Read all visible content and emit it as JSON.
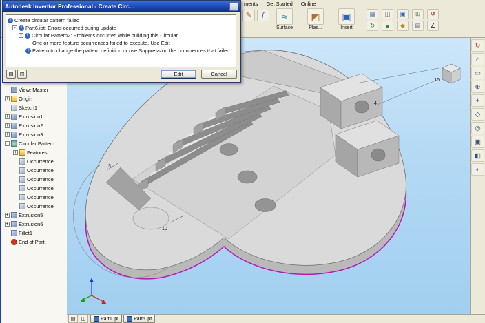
{
  "dialog": {
    "title": "Autodesk Inventor Professional - Create Circ...",
    "messages": [
      {
        "text": "Create circular pattern failed",
        "depth": "d0",
        "exp": "none",
        "icon": "info"
      },
      {
        "text": "Part6.ipt: Errors occurred during update",
        "depth": "d1",
        "exp": "minus",
        "icon": "info"
      },
      {
        "text": "Circular Pattern2: Problems occurred while building this Circular",
        "depth": "d2",
        "exp": "minus",
        "icon": "info"
      },
      {
        "text": "One or more feature occurrences failed to execute.  Use Edit",
        "depth": "d3",
        "exp": "none",
        "icon": "none"
      },
      {
        "text": "Pattern to change the pattern definition or use Suppress on the occurrences that failed.",
        "depth": "d3b",
        "exp": "none",
        "icon": "info"
      }
    ],
    "toolbar_buttons": [
      {
        "name": "save-report-icon",
        "glyph": "▤"
      },
      {
        "name": "copy-icon",
        "glyph": "◫"
      }
    ],
    "edit_label": "Edit",
    "cancel_label": "Cancel"
  },
  "menubar": {
    "items": [
      "ments",
      "Get Started",
      "Online"
    ]
  },
  "toolbar": {
    "lead_icons": [
      {
        "name": "sketch-icon",
        "glyph": "✎",
        "color": "#b05a20"
      },
      {
        "name": "parameters-fx-icon",
        "glyph": "ƒ",
        "color": "#2f5fa8"
      }
    ],
    "groups": [
      {
        "label": "Surface",
        "glyph": "≈",
        "color": "#3a8ab0"
      },
      {
        "label": "Plas...",
        "glyph": "◩",
        "color": "#b07030"
      },
      {
        "label": "Insert",
        "glyph": "▣",
        "color": "#2a62b8"
      }
    ],
    "small_icons": [
      {
        "name": "grid-icon",
        "glyph": "▦",
        "color": "#4a7ab8"
      },
      {
        "name": "window-icon",
        "glyph": "◫",
        "color": "#6a6a6a"
      },
      {
        "name": "box-icon",
        "glyph": "▣",
        "color": "#2a62b8"
      },
      {
        "name": "add-icon",
        "glyph": "⊞",
        "color": "#557755"
      },
      {
        "name": "undo-icon",
        "glyph": "↺",
        "color": "#a02020"
      },
      {
        "name": "redo-icon",
        "glyph": "↻",
        "color": "#208020"
      },
      {
        "name": "sphere-icon",
        "glyph": "●",
        "color": "#209020"
      },
      {
        "name": "diamond-icon",
        "glyph": "◆",
        "color": "#d08020"
      },
      {
        "name": "list-icon",
        "glyph": "▤",
        "color": "#556677"
      },
      {
        "name": "angle-icon",
        "glyph": "∠",
        "color": "#333333"
      }
    ]
  },
  "browser": {
    "items": [
      {
        "label": "View: Master",
        "depth": "t0",
        "exp": "none",
        "icon": "ic-view"
      },
      {
        "label": "Origin",
        "depth": "t0",
        "exp": "plus",
        "icon": "ic-folder"
      },
      {
        "label": "Sketch1",
        "depth": "t0",
        "exp": "none",
        "icon": "ic-sketch"
      },
      {
        "label": "Extrusion1",
        "depth": "t0",
        "exp": "plus",
        "icon": "ic-extr"
      },
      {
        "label": "Extrusion2",
        "depth": "t0",
        "exp": "plus",
        "icon": "ic-extr"
      },
      {
        "label": "Extrusion3",
        "depth": "t0",
        "exp": "plus",
        "icon": "ic-extr"
      },
      {
        "label": "Circular Pattern",
        "depth": "t0",
        "exp": "minus",
        "icon": "ic-pattern"
      },
      {
        "label": "Features",
        "depth": "t1",
        "exp": "plus",
        "icon": "ic-folder"
      },
      {
        "label": "Occurrence",
        "depth": "t1",
        "exp": "none",
        "icon": "ic-occ"
      },
      {
        "label": "Occurrence",
        "depth": "t1",
        "exp": "none",
        "icon": "ic-occ"
      },
      {
        "label": "Occurrence",
        "depth": "t1",
        "exp": "none",
        "icon": "ic-occ"
      },
      {
        "label": "Occurrence",
        "depth": "t1",
        "exp": "none",
        "icon": "ic-occ"
      },
      {
        "label": "Occurrence",
        "depth": "t1",
        "exp": "none",
        "icon": "ic-occ"
      },
      {
        "label": "Occurrence",
        "depth": "t1",
        "exp": "none",
        "icon": "ic-occ"
      },
      {
        "label": "Extrusion5",
        "depth": "t0",
        "exp": "plus",
        "icon": "ic-extr"
      },
      {
        "label": "Extrusion6",
        "depth": "t0",
        "exp": "plus",
        "icon": "ic-extr"
      },
      {
        "label": "Fillet1",
        "depth": "t0",
        "exp": "none",
        "icon": "ic-fillet"
      },
      {
        "label": "End of Part",
        "depth": "t0",
        "exp": "none",
        "icon": "ic-end"
      }
    ]
  },
  "viewport": {
    "dim_labels": [
      "10",
      "3",
      "4",
      "10"
    ]
  },
  "right_toolbar": {
    "items": [
      {
        "name": "update-icon",
        "glyph": "↻",
        "color": "#a03020"
      },
      {
        "name": "zoom-all-icon",
        "glyph": "⌂",
        "color": "#33506e"
      },
      {
        "name": "zoom-window-icon",
        "glyph": "▭",
        "color": "#33506e"
      },
      {
        "name": "zoom-icon",
        "glyph": "⊕",
        "color": "#33506e"
      },
      {
        "name": "pan-icon",
        "glyph": "+",
        "color": "#33506e"
      },
      {
        "name": "look-at-icon",
        "glyph": "◇",
        "color": "#33506e"
      },
      {
        "name": "orbit-icon",
        "glyph": "◎",
        "color": "#33506e"
      },
      {
        "name": "view-cube-icon",
        "glyph": "▣",
        "color": "#33506e"
      },
      {
        "name": "display-mode-icon",
        "glyph": "◧",
        "color": "#33506e"
      },
      {
        "name": "shadow-icon",
        "glyph": "◐",
        "color": "#33506e"
      }
    ]
  },
  "bottom_bar": {
    "buttons": [
      {
        "name": "tile-windows-icon",
        "glyph": "▤"
      },
      {
        "name": "cascade-windows-icon",
        "glyph": "◫"
      }
    ],
    "tabs": [
      {
        "label": "Part1.ipt"
      },
      {
        "label": "Part5.ipt"
      }
    ]
  }
}
